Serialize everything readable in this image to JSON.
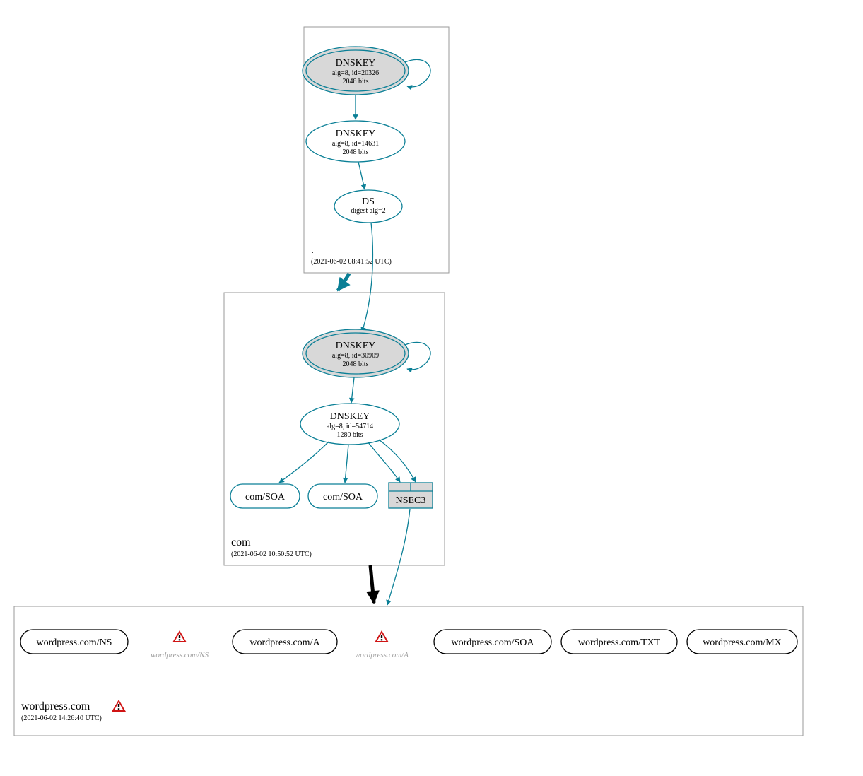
{
  "colors": {
    "teal": "#0a7f96",
    "node_grey": "#d8d8d8",
    "zone_border": "#9a9a9a",
    "warn_red": "#d01414",
    "warn_yellow": "#f5e24a"
  },
  "zones": {
    "root": {
      "label": ".",
      "timestamp": "(2021-06-02 08:41:52 UTC)"
    },
    "com": {
      "label": "com",
      "timestamp": "(2021-06-02 10:50:52 UTC)"
    },
    "wp": {
      "label": "wordpress.com",
      "timestamp": "(2021-06-02 14:26:40 UTC)",
      "has_warn": true
    }
  },
  "nodes": {
    "root_ksk": {
      "title": "DNSKEY",
      "sub1": "alg=8, id=20326",
      "sub2": "2048 bits"
    },
    "root_zsk": {
      "title": "DNSKEY",
      "sub1": "alg=8, id=14631",
      "sub2": "2048 bits"
    },
    "root_ds": {
      "title": "DS",
      "sub1": "digest alg=2"
    },
    "com_ksk": {
      "title": "DNSKEY",
      "sub1": "alg=8, id=30909",
      "sub2": "2048 bits"
    },
    "com_zsk": {
      "title": "DNSKEY",
      "sub1": "alg=8, id=54714",
      "sub2": "1280 bits"
    },
    "com_soa1": {
      "title": "com/SOA"
    },
    "com_soa2": {
      "title": "com/SOA"
    },
    "com_nsec3": {
      "title": "NSEC3"
    },
    "wp_ns_box": {
      "title": "wordpress.com/NS"
    },
    "wp_ns_text": {
      "title": "wordpress.com/NS"
    },
    "wp_a_box": {
      "title": "wordpress.com/A"
    },
    "wp_a_text": {
      "title": "wordpress.com/A"
    },
    "wp_soa": {
      "title": "wordpress.com/SOA"
    },
    "wp_txt": {
      "title": "wordpress.com/TXT"
    },
    "wp_mx": {
      "title": "wordpress.com/MX"
    }
  }
}
